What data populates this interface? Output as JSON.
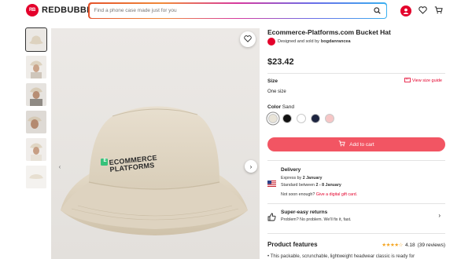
{
  "header": {
    "logo_mark": "RB",
    "logo_text": "REDBUBBLE",
    "search_placeholder": "Find a phone case made just for you"
  },
  "product": {
    "title": "Ecommerce-Platforms.com Bucket Hat",
    "seller_prefix": "Designed and sold by",
    "seller_name": "bogdanrancea",
    "price": "$23.42",
    "hat_print_line1": "ECOMMERCE",
    "hat_print_line2": "PLATFORMS",
    "hat_print_logo": "E"
  },
  "size": {
    "label": "Size",
    "guide_label": "View size guide",
    "value": "One size"
  },
  "color": {
    "label": "Color",
    "selected": "Sand",
    "swatches": [
      "#e9e4d8",
      "#111111",
      "#ffffff",
      "#1d2540",
      "#f6c6c6"
    ]
  },
  "cart": {
    "label": "Add to cart"
  },
  "delivery": {
    "title": "Delivery",
    "express_prefix": "Express by",
    "express_date": "2 January",
    "standard_prefix": "Standard between",
    "standard_date": "2 - 8 January",
    "not_soon": "Not soon enough?",
    "gift_link": "Give a digital gift card."
  },
  "returns": {
    "title": "Super-easy returns",
    "subtitle": "Problem? No problem. We'll fix it, fast."
  },
  "features": {
    "title": "Product features",
    "rating": "4.18",
    "reviews": "(39 reviews)",
    "first_line": "This packable, scrunchable, lightweight headwear classic is ready for"
  },
  "colors": {
    "brand": "#e4002b",
    "cart_button": "#f25563",
    "star": "#f5a623"
  }
}
